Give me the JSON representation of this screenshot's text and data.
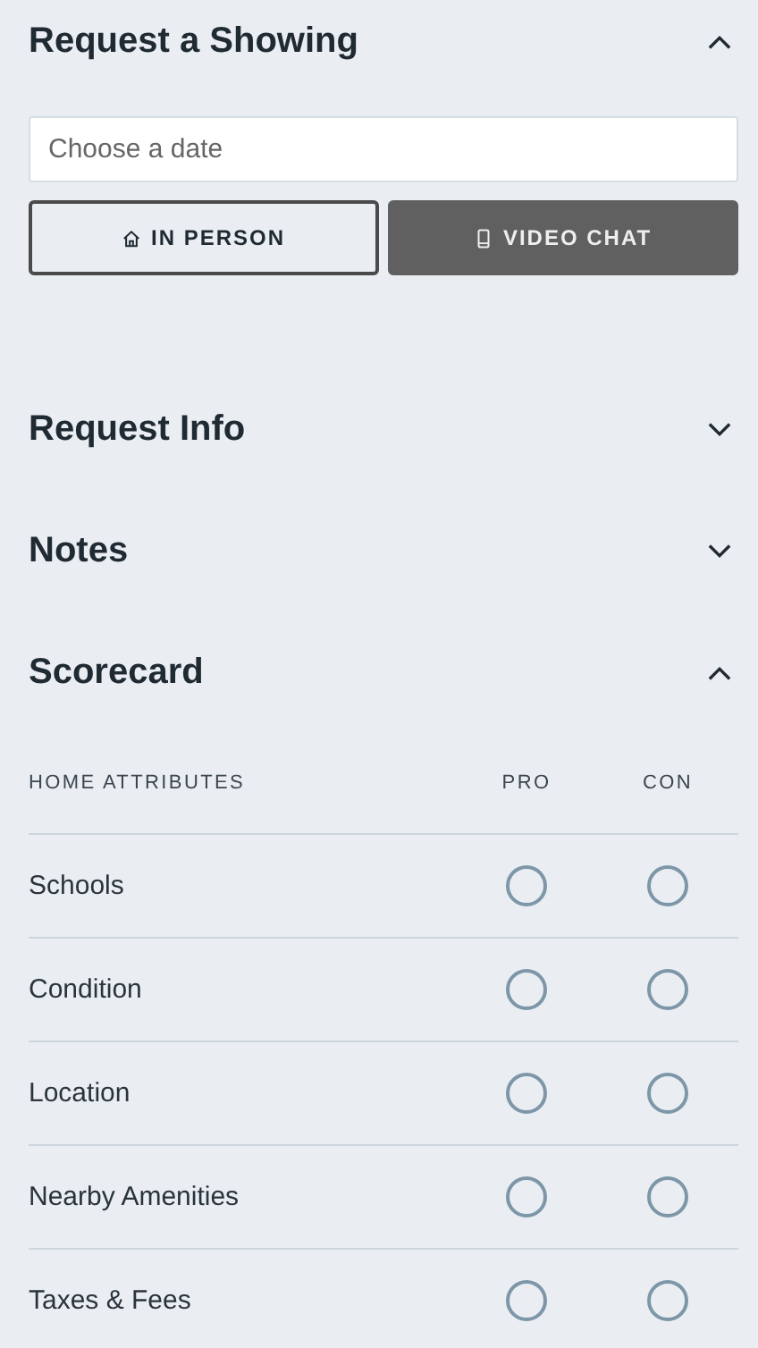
{
  "showing": {
    "title": "Request a Showing",
    "expanded": true,
    "date_field": {
      "placeholder": "Choose a date"
    },
    "modes": [
      {
        "kind": "home",
        "label": "IN PERSON",
        "selected": false
      },
      {
        "kind": "phone",
        "label": "VIDEO CHAT",
        "selected": true
      }
    ]
  },
  "sections": [
    {
      "title": "Request Info",
      "expanded": false
    },
    {
      "title": "Notes",
      "expanded": false
    }
  ],
  "scorecard": {
    "title": "Scorecard",
    "expanded": true,
    "columns": [
      "HOME ATTRIBUTES",
      "PRO",
      "CON"
    ],
    "rows": [
      {
        "label": "Schools",
        "pro": false,
        "con": false
      },
      {
        "label": "Condition",
        "pro": false,
        "con": false
      },
      {
        "label": "Location",
        "pro": false,
        "con": false
      },
      {
        "label": "Nearby Amenities",
        "pro": false,
        "con": false
      },
      {
        "label": "Taxes & Fees",
        "pro": false,
        "con": false
      }
    ]
  }
}
